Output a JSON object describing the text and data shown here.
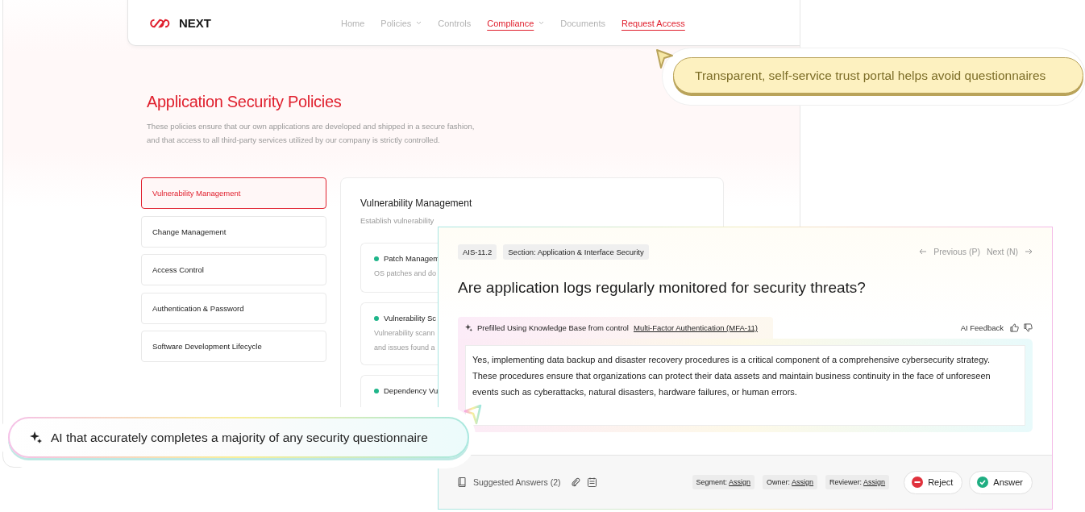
{
  "site": {
    "logo": "NEXT",
    "nav": [
      {
        "label": "Home",
        "highlighted": false,
        "dropdown": false
      },
      {
        "label": "Policies",
        "highlighted": false,
        "dropdown": true
      },
      {
        "label": "Controls",
        "highlighted": false,
        "dropdown": false
      },
      {
        "label": "Compliance",
        "highlighted": true,
        "dropdown": true
      },
      {
        "label": "Documents",
        "highlighted": false,
        "dropdown": false
      },
      {
        "label": "Request Access",
        "highlighted": true,
        "dropdown": false
      }
    ],
    "title": "Application Security Policies",
    "description": "These policies ensure that our own applications are developed and shipped in a secure fashion, and that access to all third-party services utilized by our company is strictly controlled.",
    "policies": [
      {
        "label": "Vulnerability Management",
        "selected": true
      },
      {
        "label": "Change Management",
        "selected": false
      },
      {
        "label": "Access Control",
        "selected": false
      },
      {
        "label": "Authentication & Password",
        "selected": false
      },
      {
        "label": "Software Development Lifecycle",
        "selected": false
      }
    ],
    "detail": {
      "title": "Vulnerability Management",
      "subtitle": "Establish vulnerability",
      "items": [
        {
          "title": "Patch Managem",
          "lines": [
            "OS patches and do"
          ]
        },
        {
          "title": "Vulnerability Sc",
          "lines": [
            "Vulnerability scann",
            "and issues found a"
          ]
        },
        {
          "title": "Dependency Vu"
        }
      ]
    }
  },
  "question": {
    "id": "AIS-11.2",
    "section": "Section: Application & Interface Security",
    "previous": "Previous (P)",
    "next": "Next (N)",
    "text": "Are application logs regularly monitored for security threats?",
    "prefill": {
      "prefix": "Prefilled Using Knowledge Base from control",
      "link": "Multi-Factor Authentication (MFA-11)"
    },
    "feedback_label": "AI Feedback",
    "answer": "Yes, implementing data backup and disaster recovery procedures is a critical component of a comprehensive cybersecurity strategy. These procedures ensure that organizations can protect their data assets and maintain business continuity in the face of unforeseen events such as cyberattacks, natural disasters, hardware failures, or human errors.",
    "footer": {
      "suggested": "Suggested Answers (2)",
      "assignments": [
        {
          "label": "Segment:",
          "value": "Assign"
        },
        {
          "label": "Owner:",
          "value": "Assign"
        },
        {
          "label": "Reviewer:",
          "value": "Assign"
        }
      ],
      "buttons": [
        {
          "label": "Reject",
          "kind": "reject"
        },
        {
          "label": "Answer",
          "kind": "accept"
        }
      ]
    }
  },
  "callouts": [
    {
      "kind": "gold",
      "text": "Transparent, self-service trust portal helps avoid questionnaires"
    },
    {
      "kind": "gradient",
      "text": "AI that accurately completes a majority of any security questionnaire"
    }
  ]
}
